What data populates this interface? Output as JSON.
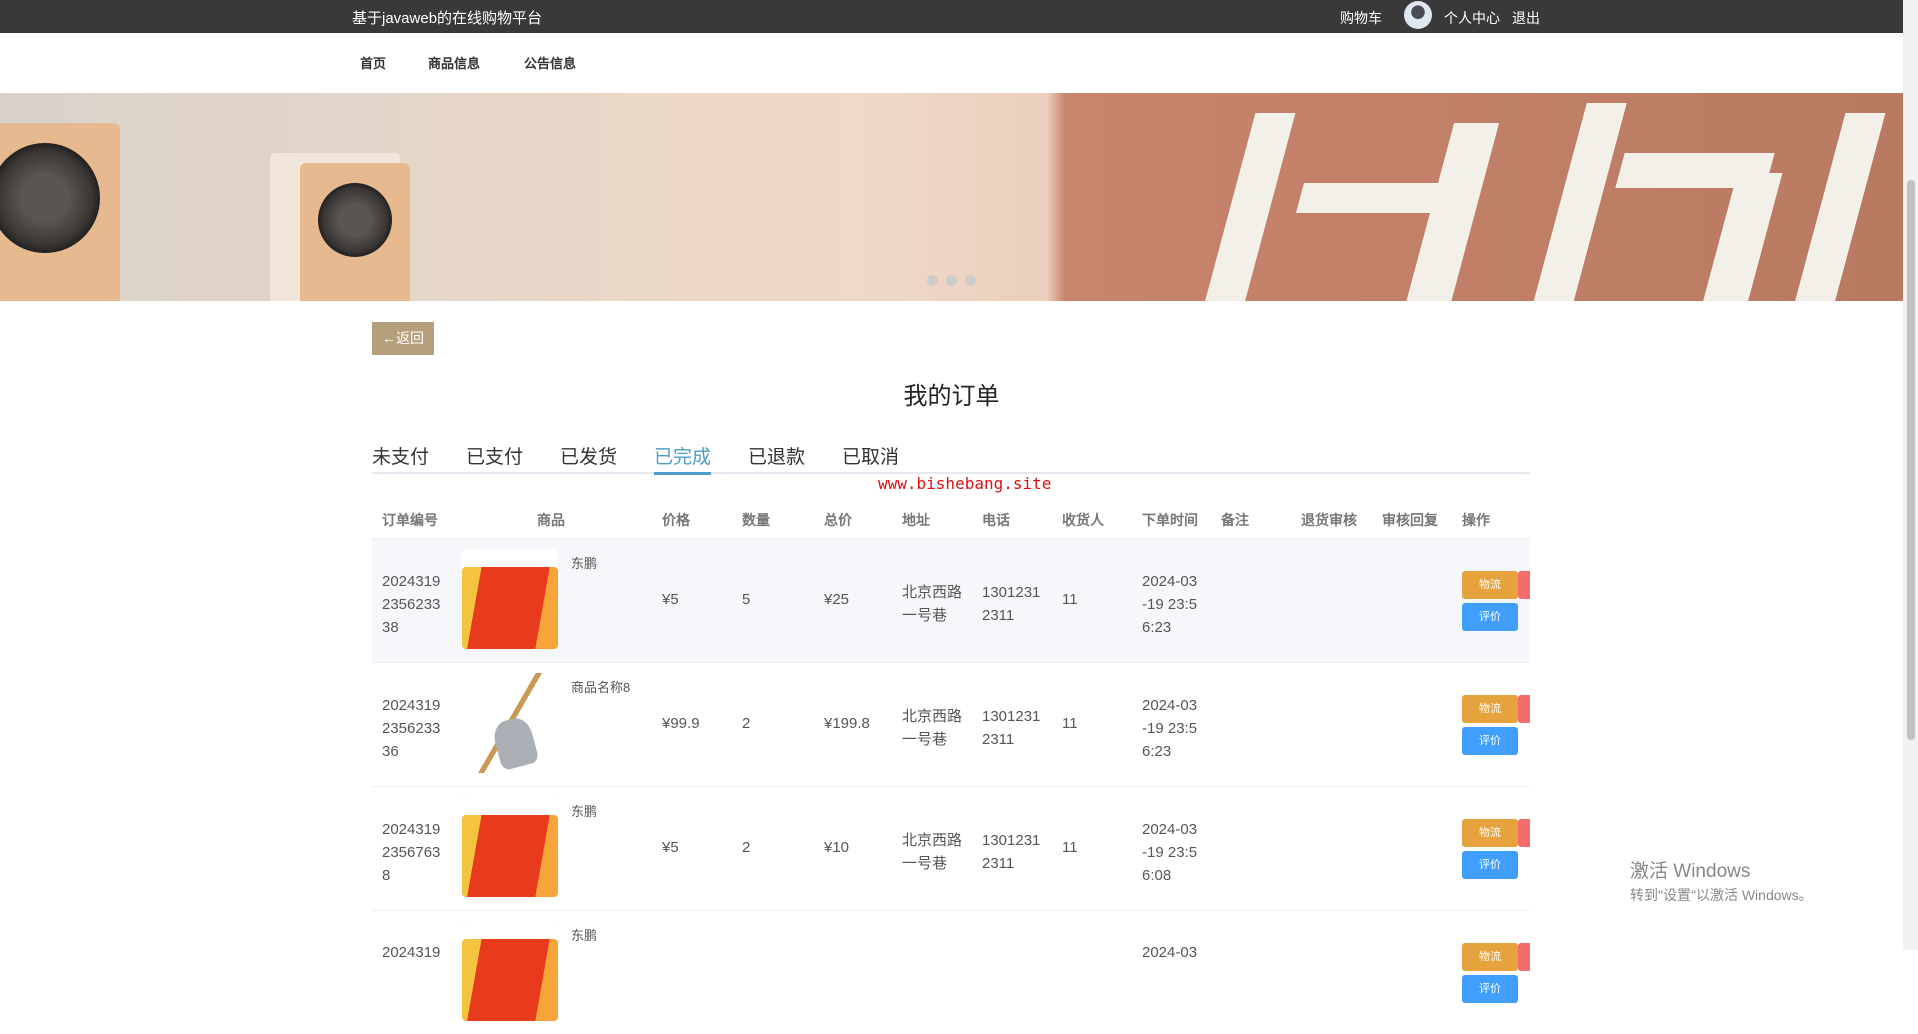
{
  "header": {
    "brand": "基于javaweb的在线购物平台",
    "cart": "购物车",
    "profile": "个人中心",
    "logout": "退出"
  },
  "nav": [
    "首页",
    "商品信息",
    "公告信息"
  ],
  "back_label": "←返回",
  "page_title": "我的订单",
  "tabs": [
    "未支付",
    "已支付",
    "已发货",
    "已完成",
    "已退款",
    "已取消"
  ],
  "active_tab": "已完成",
  "watermark": "www.bishebang.site",
  "columns": [
    "订单编号",
    "商品",
    "价格",
    "数量",
    "总价",
    "地址",
    "电话",
    "收货人",
    "下单时间",
    "备注",
    "退货审核",
    "审核回复",
    "操作"
  ],
  "rows": [
    {
      "id": "2024319235623338",
      "product": "东鹏",
      "price": "¥5",
      "qty": "5",
      "total": "¥25",
      "address": "北京西路一号巷",
      "phone": "13012312311",
      "receiver": "11",
      "time": "2024-03-19 23:56:23"
    },
    {
      "id": "2024319235623336",
      "product": "商品名称8",
      "price": "¥99.9",
      "qty": "2",
      "total": "¥199.8",
      "address": "北京西路一号巷",
      "phone": "13012312311",
      "receiver": "11",
      "time": "2024-03-19 23:56:23"
    },
    {
      "id": "20243192356763 8",
      "product": "东鹏",
      "price": "¥5",
      "qty": "2",
      "total": "¥10",
      "address": "北京西路一号巷",
      "phone": "13012312311",
      "receiver": "11",
      "time": "2024-03-19 23:56:08"
    },
    {
      "id": "2024319",
      "product": "东鹏",
      "price": "",
      "qty": "",
      "total": "",
      "address": "",
      "phone": "",
      "receiver": "",
      "time": "2024-03"
    }
  ],
  "actions": {
    "logistics": "物流",
    "review": "评价"
  },
  "windows": {
    "line1": "激活 Windows",
    "line2": "转到\"设置\"以激活 Windows。"
  }
}
